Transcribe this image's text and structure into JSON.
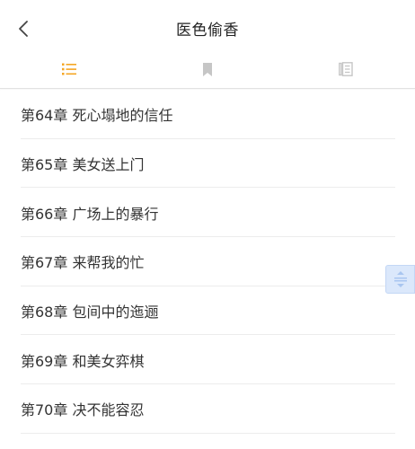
{
  "header": {
    "title": "医色偷香",
    "back_icon": "chevron-left-icon"
  },
  "tabs": [
    {
      "name": "catalog",
      "icon": "list-icon",
      "active": true
    },
    {
      "name": "bookmarks",
      "icon": "bookmark-icon",
      "active": false
    },
    {
      "name": "notes",
      "icon": "notes-icon",
      "active": false
    }
  ],
  "colors": {
    "accent": "#f5a623",
    "inactive_icon": "#c6c6c6",
    "text": "#333333",
    "divider": "#ececec",
    "scroll_handle": "#dbe8fb",
    "scroll_handle_icon": "#a9c6f0"
  },
  "chapters": [
    {
      "label": "第64章 死心塌地的信任"
    },
    {
      "label": "第65章 美女送上门"
    },
    {
      "label": "第66章 广场上的暴行"
    },
    {
      "label": "第67章 来帮我的忙"
    },
    {
      "label": "第68章 包间中的迤逦"
    },
    {
      "label": "第69章 和美女弈棋"
    },
    {
      "label": "第70章 决不能容忍"
    }
  ],
  "scroll_handle_icon": "drag-handle-icon"
}
